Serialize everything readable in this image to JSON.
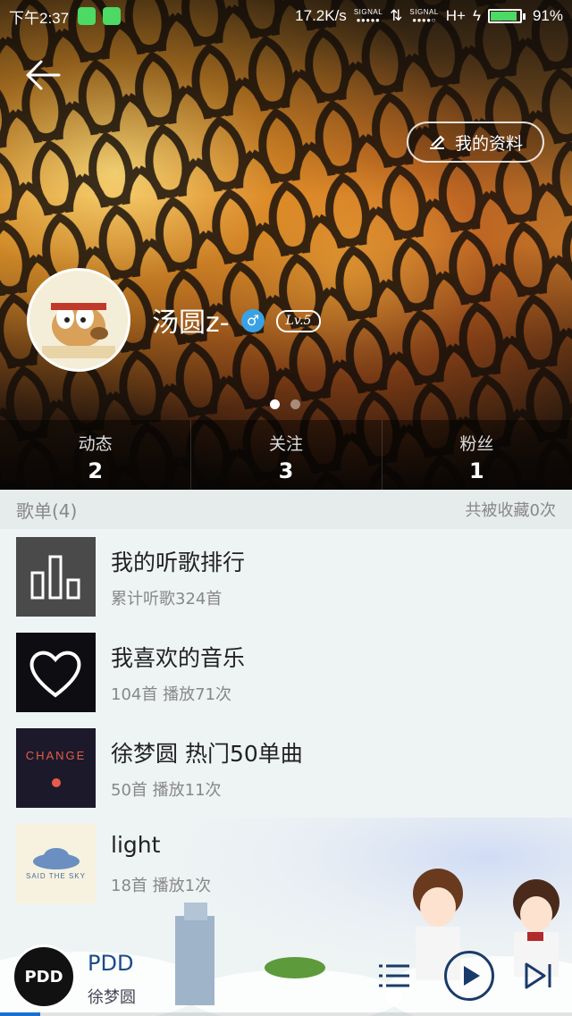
{
  "status_bar": {
    "time": "下午2:37",
    "net_speed": "17.2K/s",
    "signal_label": "SIGNAL",
    "network_type": "H+",
    "battery": "91%",
    "battery_level": 0.91
  },
  "header": {
    "edit_profile_label": "我的资料"
  },
  "profile": {
    "username": "汤圆z-",
    "gender_symbol": "♂",
    "level": "Lv.5",
    "page_count": 2,
    "active_page": 1
  },
  "stats": [
    {
      "label": "动态",
      "value": "2"
    },
    {
      "label": "关注",
      "value": "3"
    },
    {
      "label": "粉丝",
      "value": "1"
    }
  ],
  "playlists_section": {
    "title": "歌单(4)",
    "collected": "共被收藏0次"
  },
  "playlists": [
    {
      "title": "我的听歌排行",
      "subtitle": "累计听歌324首",
      "cover": "bar-chart-icon"
    },
    {
      "title": "我喜欢的音乐",
      "subtitle": "104首 播放71次",
      "cover": "heart-icon"
    },
    {
      "title": "徐梦圆 热门50单曲",
      "subtitle": "50首 播放11次",
      "cover_text": "CHANGE"
    },
    {
      "title": "light",
      "subtitle": "18首 播放1次",
      "cover_text": "SAID THE SKY"
    }
  ],
  "player": {
    "song": "PDD",
    "artist": "徐梦圆",
    "disc_text": "PDD",
    "progress": 0.07
  },
  "colors": {
    "accent": "#1a6fd0",
    "gender": "#3aa2e4",
    "battery": "#4cd964"
  }
}
